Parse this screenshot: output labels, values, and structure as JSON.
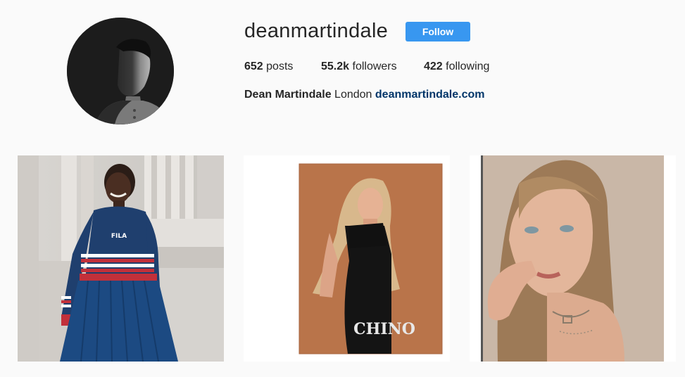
{
  "profile": {
    "username": "deanmartindale",
    "follow_label": "Follow",
    "stats": {
      "posts_count": "652",
      "posts_label": "posts",
      "followers_count": "55.2k",
      "followers_label": "followers",
      "following_count": "422",
      "following_label": "following"
    },
    "bio": {
      "full_name": "Dean Martindale",
      "location": "London",
      "website": "deanmartindale.com"
    }
  },
  "posts": [
    {
      "overlay_text": "FILA"
    },
    {
      "overlay_text": "CHINO"
    },
    {
      "overlay_text": ""
    }
  ],
  "colors": {
    "accent": "#3897f0",
    "link": "#003569",
    "background": "#fafafa"
  }
}
